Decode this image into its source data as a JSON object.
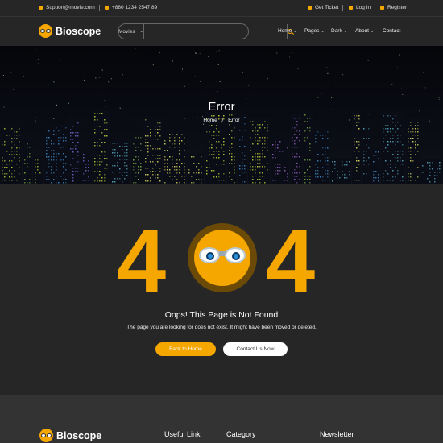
{
  "topbar": {
    "email": "Support@movie.com",
    "phone": "+880 1234 2547 89",
    "get_ticket": "Get Ticket",
    "login": "Log In",
    "register": "Register"
  },
  "header": {
    "logo_text": "Bioscope",
    "search": {
      "category": "Movies",
      "value": ""
    },
    "nav": [
      "Home",
      "Pages",
      "Dark",
      "About",
      "Contact"
    ]
  },
  "hero": {
    "title": "Error",
    "breadcrumb_home": "Home",
    "breadcrumb_sep": "/",
    "breadcrumb_current": "Error"
  },
  "error": {
    "digit_left": "4",
    "digit_right": "4",
    "heading": "Oops! This Page is Not Found",
    "description": "The page you are looking for does not exist. It might have been moved or deleted.",
    "home_button": "Back to Home",
    "contact_button": "Contact Us Now"
  },
  "footer": {
    "logo_text": "Bioscope",
    "col1": "Useful Link",
    "col2": "Category",
    "col3": "Newsletter"
  },
  "colors": {
    "accent": "#f5a700",
    "background": "#262626",
    "footer": "#333333"
  },
  "icons": [
    "email-icon",
    "phone-icon",
    "ticket-icon",
    "lock-icon",
    "user-icon",
    "search-icon",
    "chevron-down-icon"
  ]
}
